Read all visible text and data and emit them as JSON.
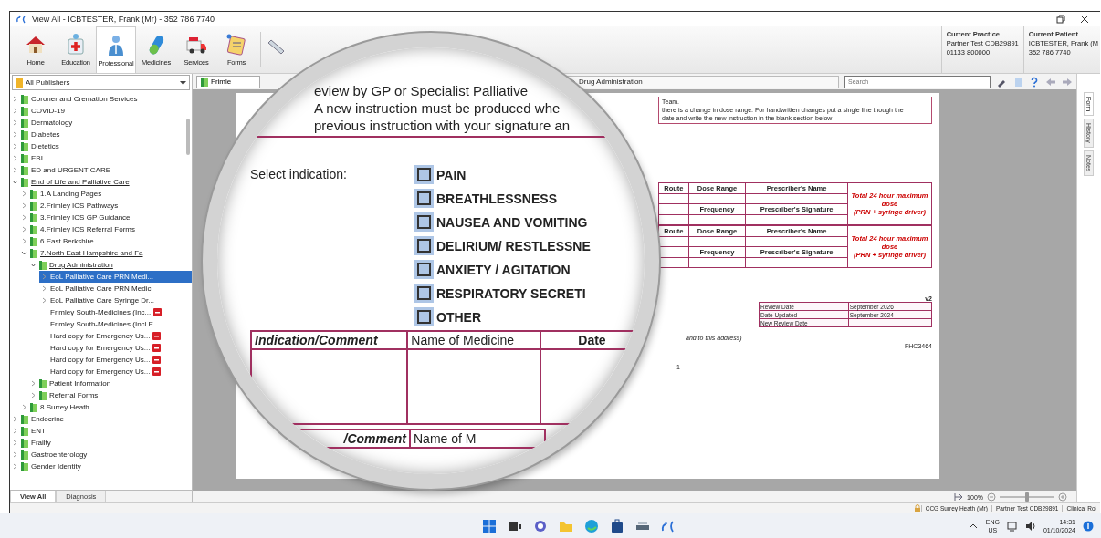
{
  "window": {
    "title": "View All - ICBTESTER, Frank (Mr) - 352 786 7740"
  },
  "toolbar": [
    {
      "label": "Home",
      "selected": false
    },
    {
      "label": "Education",
      "selected": false
    },
    {
      "label": "Professional",
      "selected": true
    },
    {
      "label": "Medicines",
      "selected": false
    },
    {
      "label": "Services",
      "selected": false
    },
    {
      "label": "Forms",
      "selected": false
    }
  ],
  "current_practice": {
    "heading": "Current Practice",
    "lines": [
      "Partner Test CDB29891",
      "01133 800000"
    ]
  },
  "current_patient": {
    "heading": "Current Patient",
    "lines": [
      "ICBTESTER, Frank (M",
      "352 786 7740"
    ]
  },
  "publisher_select": {
    "value": "All Publishers"
  },
  "tree": [
    {
      "label": "Coroner and Cremation Services",
      "kind": "folder",
      "expanded": false,
      "selected": false
    },
    {
      "label": "COVID-19",
      "kind": "folder",
      "expanded": false,
      "selected": false
    },
    {
      "label": "Dermatology",
      "kind": "folder",
      "expanded": false,
      "selected": false
    },
    {
      "label": "Diabetes",
      "kind": "folder",
      "expanded": false,
      "selected": false
    },
    {
      "label": "Dietetics",
      "kind": "folder",
      "expanded": false,
      "selected": false
    },
    {
      "label": "EBI",
      "kind": "folder",
      "expanded": false,
      "selected": false
    },
    {
      "label": "ED and URGENT CARE",
      "kind": "folder",
      "expanded": false,
      "selected": false
    },
    {
      "label": "End of Life and Palliative Care",
      "kind": "folder",
      "expanded": true,
      "selected": false,
      "children": [
        {
          "label": "1.A Landing Pages",
          "kind": "folder",
          "expanded": false,
          "selected": false
        },
        {
          "label": "2.Frimley ICS Pathways",
          "kind": "folder",
          "expanded": false,
          "selected": false
        },
        {
          "label": "3.Frimley ICS GP Guidance",
          "kind": "folder",
          "expanded": false,
          "selected": false
        },
        {
          "label": "4.Frimley ICS Referral Forms",
          "kind": "folder",
          "expanded": false,
          "selected": false
        },
        {
          "label": "6.East Berkshire",
          "kind": "folder",
          "expanded": false,
          "selected": false
        },
        {
          "label": "7.North East Hampshire and Fa",
          "kind": "folder",
          "expanded": true,
          "selected": false,
          "children": [
            {
              "label": "Drug Administration",
              "kind": "folder",
              "expanded": true,
              "selected": false,
              "children": [
                {
                  "label": "EoL Palliative Care PRN Medi...",
                  "kind": "document",
                  "expanded": false,
                  "selected": true
                },
                {
                  "label": "EoL Palliative Care PRN Medic",
                  "kind": "document",
                  "expanded": false,
                  "selected": false
                },
                {
                  "label": "EoL Palliative Care Syringe Dr...",
                  "kind": "document",
                  "expanded": false,
                  "selected": false
                },
                {
                  "label": "Frimley South-Medicines (Inc...",
                  "kind": "document",
                  "flagged": true,
                  "selected": false
                },
                {
                  "label": "Frimley South-Medicines (Incl E...",
                  "kind": "document",
                  "flagged": false,
                  "selected": false
                },
                {
                  "label": "Hard copy for Emergency Us...",
                  "kind": "document",
                  "flagged": true,
                  "selected": false
                },
                {
                  "label": "Hard copy for Emergency Us...",
                  "kind": "document",
                  "flagged": true,
                  "selected": false
                },
                {
                  "label": "Hard copy for Emergency Us...",
                  "kind": "document",
                  "flagged": true,
                  "selected": false
                },
                {
                  "label": "Hard copy for Emergency Us...",
                  "kind": "document",
                  "flagged": true,
                  "selected": false
                }
              ]
            },
            {
              "label": "Patient Information",
              "kind": "folder",
              "expanded": false,
              "selected": false
            },
            {
              "label": "Referral Forms",
              "kind": "folder",
              "expanded": false,
              "selected": false
            }
          ]
        },
        {
          "label": "8.Surrey Heath",
          "kind": "folder",
          "expanded": false,
          "selected": false
        }
      ]
    },
    {
      "label": "Endocrine",
      "kind": "folder",
      "expanded": false,
      "selected": false
    },
    {
      "label": "ENT",
      "kind": "folder",
      "expanded": false,
      "selected": false
    },
    {
      "label": "Frailty",
      "kind": "folder",
      "expanded": false,
      "selected": false
    },
    {
      "label": "Gastroenterology",
      "kind": "folder",
      "expanded": false,
      "selected": false
    },
    {
      "label": "Gender Identity",
      "kind": "folder",
      "expanded": false,
      "selected": false
    }
  ],
  "left_tabs": [
    {
      "label": "View All",
      "selected": true
    },
    {
      "label": "Diagnosis",
      "selected": false
    }
  ],
  "doc_tab": {
    "label": "Frimle"
  },
  "breadcrumb": {
    "label": "Drug Administration"
  },
  "search": {
    "placeholder": "Search"
  },
  "document": {
    "notes": [
      "Team.",
      "there is a change in dose range.  For handwritten changes put a single line though the",
      "date and write the new instruction in the blank section below"
    ],
    "dose_tables": [
      {
        "route": "Route",
        "dose_range": "Dose Range",
        "prescriber_name": "Prescriber's Name",
        "maximum": "Total 24 hour maximum dose",
        "maximum_note": "(PRN + syringe driver)",
        "frequency": "Frequency",
        "signature": "Prescriber's Signature"
      },
      {
        "route": "Route",
        "dose_range": "Dose Range",
        "prescriber_name": "Prescriber's Name",
        "maximum": "Total 24 hour maximum dose",
        "maximum_note": "(PRN + syringe driver)",
        "frequency": "Frequency",
        "signature": "Prescriber's Signature"
      }
    ],
    "version": "v2",
    "review_table": [
      {
        "label": "Review Date",
        "value": "September 2026"
      },
      {
        "label": "Date Updated",
        "value": "September 2024"
      },
      {
        "label": "New Review Date"
      }
    ],
    "address_note": "and to this address)",
    "page_code": "FHC3464",
    "page_number": "1"
  },
  "magnifier": {
    "lines": [
      "eview by GP or Specialist Palliative",
      "A new instruction must be produced whe",
      "previous instruction with your signature an"
    ],
    "select_label": "Select indication:",
    "indications": [
      {
        "label": "PAIN",
        "checked": false
      },
      {
        "label": "BREATHLESSNESS",
        "checked": false
      },
      {
        "label": "NAUSEA AND VOMITING",
        "checked": false
      },
      {
        "label": "DELIRIUM/ RESTLESSNE",
        "checked": false
      },
      {
        "label": "ANXIETY / AGITATION",
        "checked": false
      },
      {
        "label": "RESPIRATORY SECRETI",
        "checked": false
      },
      {
        "label": "OTHER",
        "checked": false
      }
    ],
    "table_headers": [
      "Indication/Comment",
      "Name of Medicine",
      "Date"
    ],
    "second_table_headers": [
      "/Comment",
      "Name of M"
    ]
  },
  "side_tabs": [
    {
      "label": "Form",
      "selected": true
    },
    {
      "label": "History",
      "selected": false
    },
    {
      "label": "Notes",
      "selected": false
    }
  ],
  "zoom": {
    "reading": "100%",
    "level": 0.5
  },
  "status_bar": [
    "CCG Surrey Heath (Mr)",
    "Partner Test CDB29891",
    "Clinical Rol"
  ],
  "tray": {
    "language": "ENG",
    "region": "US",
    "time": "14:31",
    "date": "01/10/2024"
  }
}
